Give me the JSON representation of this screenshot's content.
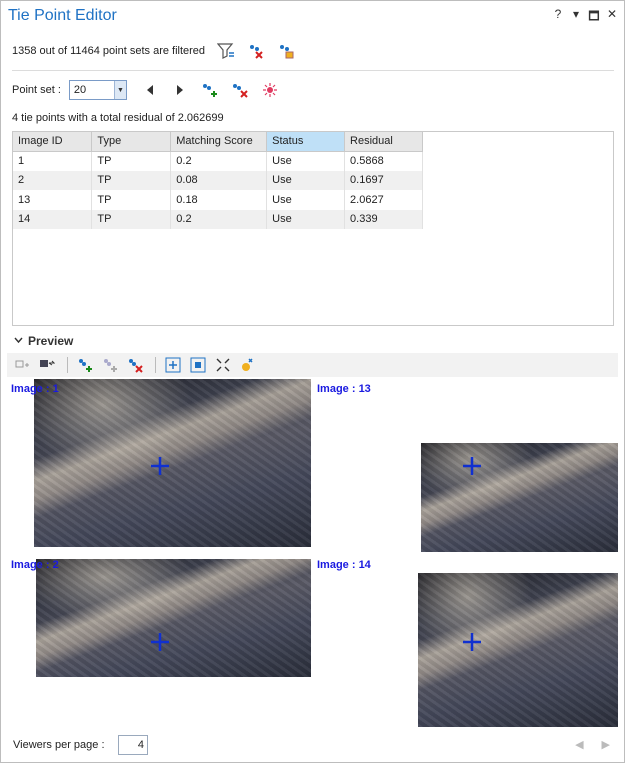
{
  "window": {
    "title": "Tie Point Editor",
    "controls": [
      "?",
      "▾",
      "🗖",
      "✕"
    ]
  },
  "filter": {
    "status_text": "1358 out of 11464 point sets are filtered"
  },
  "point_set": {
    "label": "Point set :",
    "value": "20"
  },
  "summary": {
    "text": "4   tie points with a total residual of 2.062699"
  },
  "table": {
    "headers": [
      "Image ID",
      "Type",
      "Matching Score",
      "Status",
      "Residual"
    ],
    "sorted_column": "Status",
    "rows": [
      [
        "1",
        "TP",
        "0.2",
        "Use",
        "0.5868"
      ],
      [
        "2",
        "TP",
        "0.08",
        "Use",
        "0.1697"
      ],
      [
        "13",
        "TP",
        "0.18",
        "Use",
        "2.0627"
      ],
      [
        "14",
        "TP",
        "0.2",
        "Use",
        "0.339"
      ]
    ]
  },
  "preview": {
    "heading": "Preview",
    "viewers": [
      {
        "label": "Image : 1"
      },
      {
        "label": "Image : 13"
      },
      {
        "label": "Image : 2"
      },
      {
        "label": "Image : 14"
      }
    ]
  },
  "footer": {
    "viewers_label": "Viewers per page :",
    "viewers_value": "4"
  },
  "colors": {
    "title": "#1f72c4",
    "sorted_header": "#bfe0f7",
    "viewer_label": "#1a1ae0",
    "crosshair": "#1030d0"
  }
}
